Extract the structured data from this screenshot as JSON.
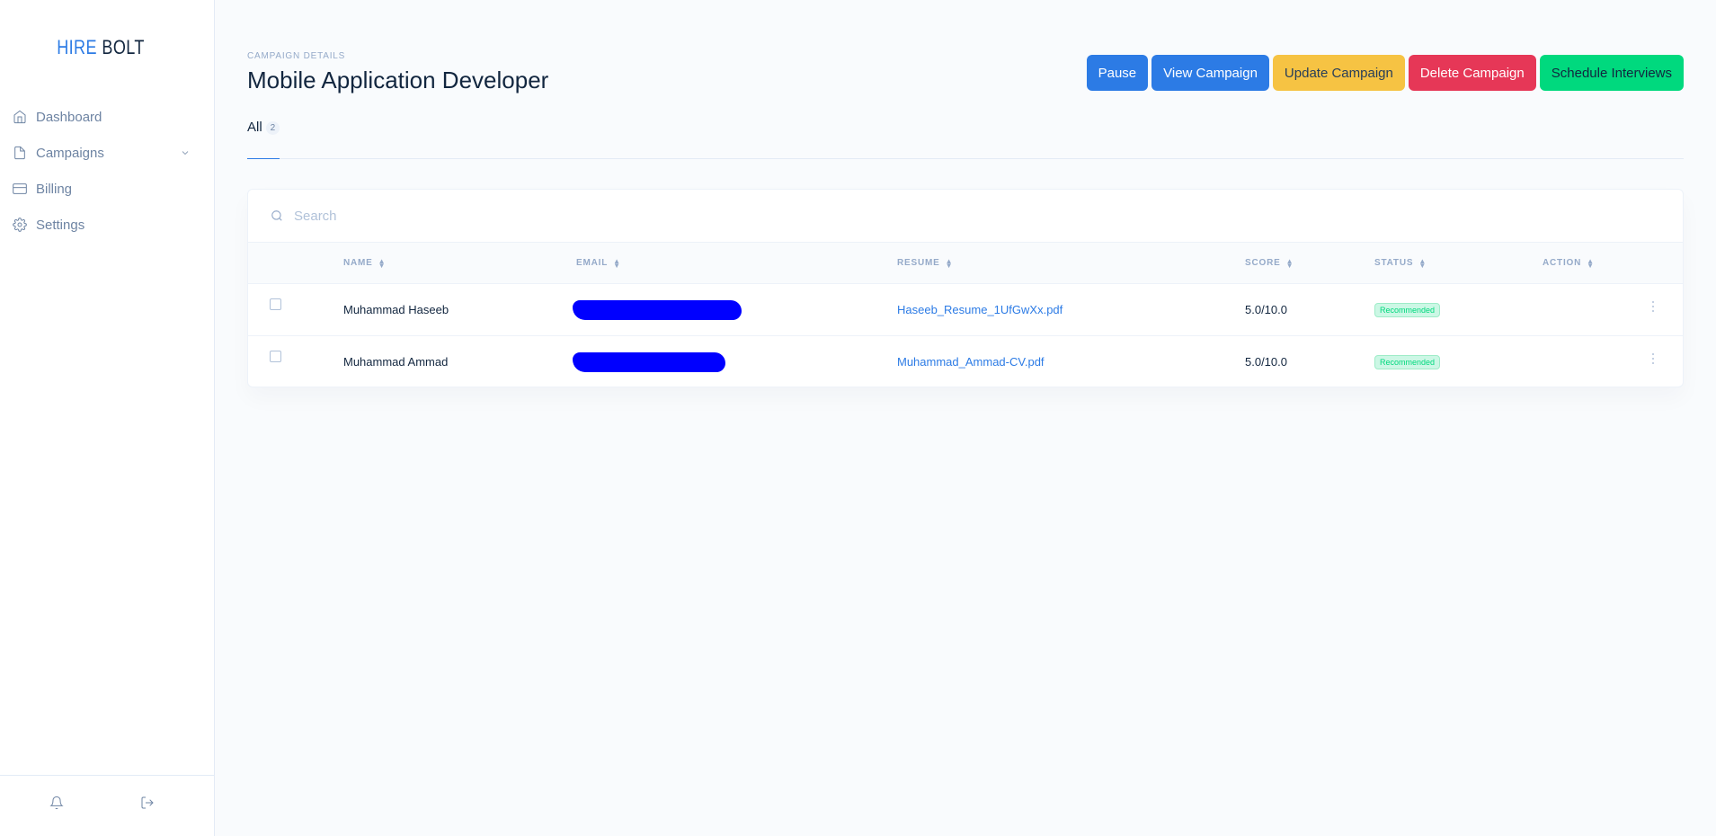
{
  "brand": {
    "part1": "HIRE",
    "part2": "BOLT"
  },
  "sidebar": {
    "items": [
      {
        "label": "Dashboard",
        "icon": "home-icon"
      },
      {
        "label": "Campaigns",
        "icon": "file-icon"
      },
      {
        "label": "Billing",
        "icon": "credit-card-icon"
      },
      {
        "label": "Settings",
        "icon": "gear-icon"
      }
    ],
    "footer_icons": [
      "bell-icon",
      "logout-icon"
    ]
  },
  "header": {
    "pretitle": "CAMPAIGN DETAILS",
    "title": "Mobile Application Developer",
    "buttons": {
      "pause": "Pause",
      "view": "View Campaign",
      "update": "Update Campaign",
      "delete": "Delete Campaign",
      "schedule": "Schedule Interviews"
    }
  },
  "tabs": [
    {
      "label": "All",
      "count": "2"
    }
  ],
  "search": {
    "placeholder": "Search"
  },
  "table": {
    "columns": [
      "NAME",
      "EMAIL",
      "RESUME",
      "SCORE",
      "STATUS",
      "ACTION"
    ],
    "rows": [
      {
        "name": "Muhammad Haseeb",
        "email": "",
        "resume": "Haseeb_Resume_1UfGwXx.pdf",
        "score": "5.0/10.0",
        "status": "Recommended"
      },
      {
        "name": "Muhammad Ammad",
        "email": "",
        "resume": "Muhammad_Ammad-CV.pdf",
        "score": "5.0/10.0",
        "status": "Recommended"
      }
    ]
  },
  "colors": {
    "primary": "#2c7be5",
    "warning": "#f6c343",
    "danger": "#e63757",
    "success": "#00d97e",
    "redaction": "#0000ff"
  }
}
